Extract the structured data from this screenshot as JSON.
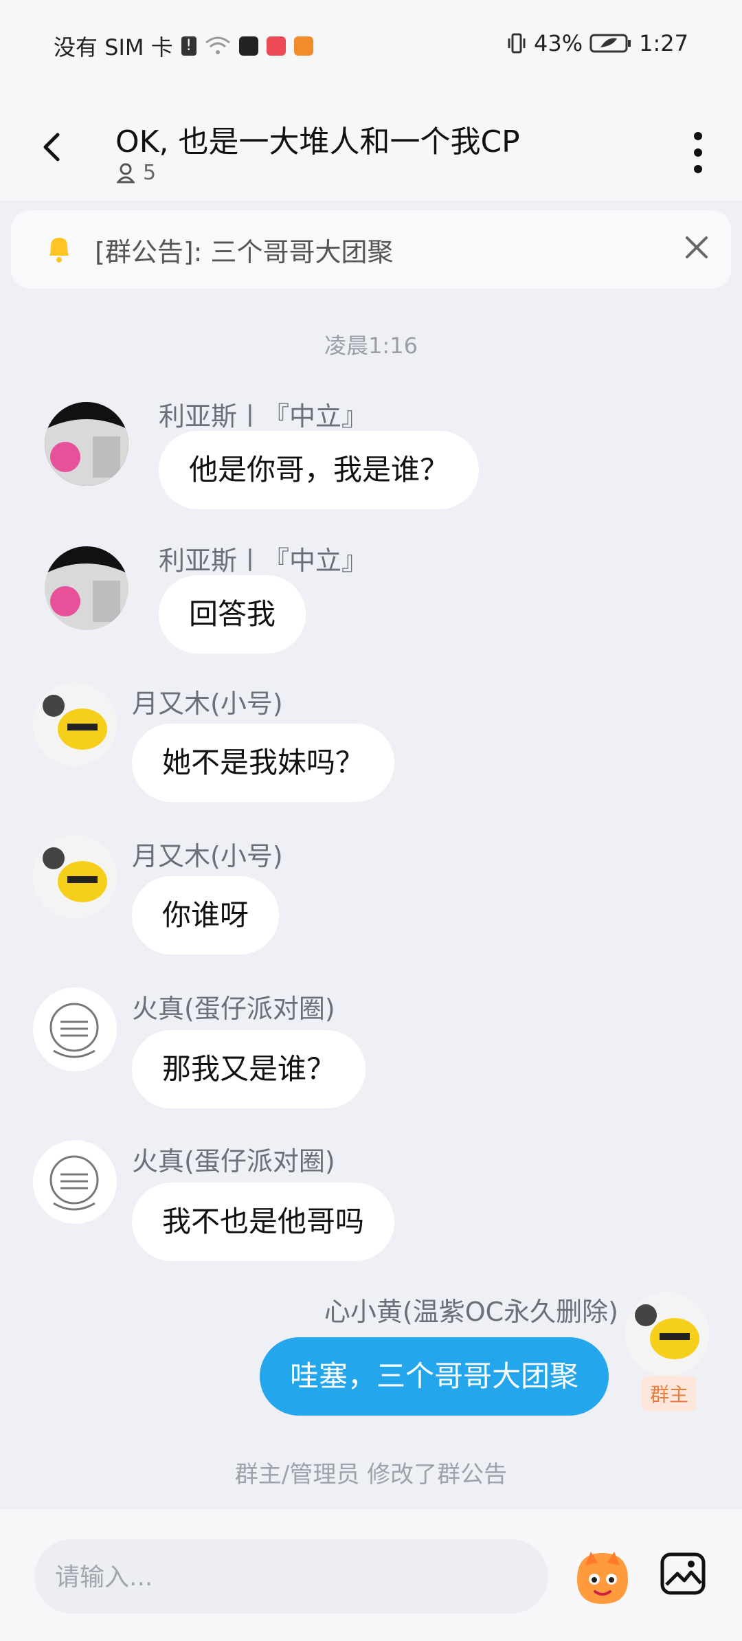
{
  "status": {
    "carrier": "没有 SIM 卡",
    "battery": "43%",
    "time": "1:27"
  },
  "header": {
    "title": "OK, 也是一大堆人和一个我CP",
    "member_count": "5"
  },
  "notice": {
    "text": "[群公告]: 三个哥哥大团聚"
  },
  "chat": {
    "timestamp": "凌晨1:16",
    "messages": [
      {
        "sender": "利亚斯〡『中立』",
        "text": "他是你哥，我是谁？"
      },
      {
        "sender": "利亚斯〡『中立』",
        "text": "回答我"
      },
      {
        "sender": "月又木(小号)",
        "text": "她不是我妹吗？"
      },
      {
        "sender": "月又木(小号)",
        "text": "你谁呀"
      },
      {
        "sender": "火真(蛋仔派对圈)",
        "text": "那我又是谁？"
      },
      {
        "sender": "火真(蛋仔派对圈)",
        "text": "我不也是他哥吗"
      },
      {
        "sender": "心小黄(温紫OC永久删除)",
        "text": "哇塞，三个哥哥大团聚",
        "role": "群主"
      }
    ],
    "system_message": "群主/管理员 修改了群公告"
  },
  "input": {
    "placeholder": "请输入..."
  },
  "colors": {
    "accent": "#24a6ec",
    "background": "#eef0f5",
    "role_badge": "#e67c3f"
  }
}
